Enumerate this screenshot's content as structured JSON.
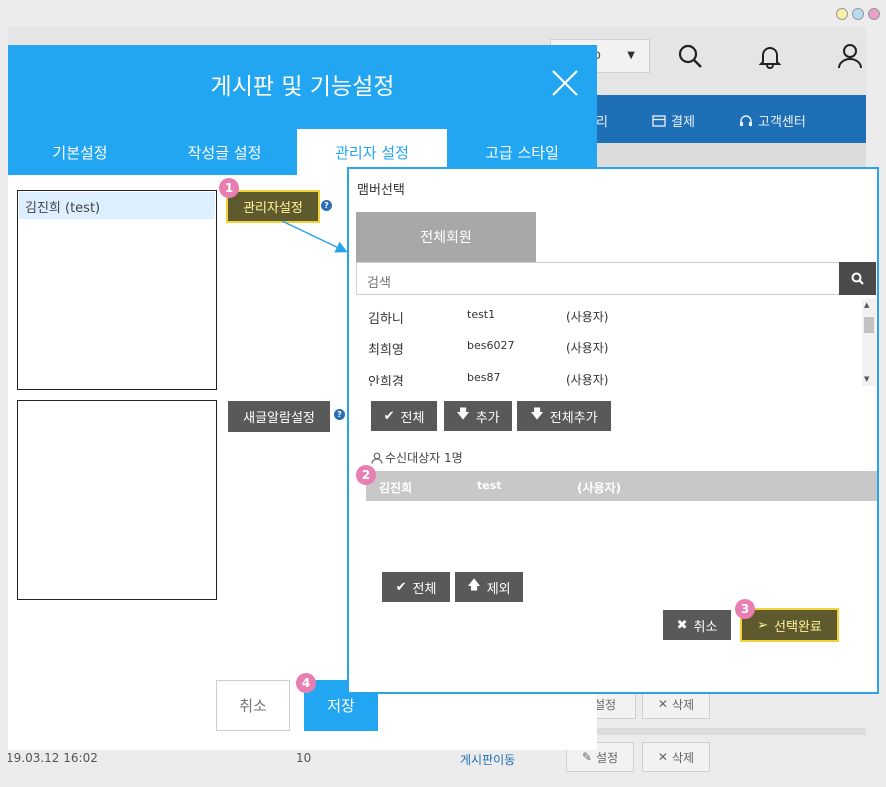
{
  "background": {
    "lang_select": "o",
    "nav": {
      "item_1": "리",
      "payment": "결제",
      "support": "고객센터"
    },
    "row1": {
      "edit": "설정",
      "delete": "삭제"
    },
    "row2": {
      "date": "19.03.12 16:02",
      "count": "10",
      "link": "게시판이동",
      "edit": "설정",
      "delete": "삭제"
    }
  },
  "dialog": {
    "title": "게시판 및 기능설정",
    "tabs": [
      "기본설정",
      "작성글 설정",
      "관리자 설정",
      "고급 스타일"
    ],
    "admin_list": [
      "김진희 (test)"
    ],
    "admin_button": "관리자설정",
    "alert_button": "새글알람설정",
    "cancel": "취소",
    "save": "저장"
  },
  "panel": {
    "title": "맴버선택",
    "tab_all": "전체회원",
    "search_placeholder": "검색",
    "members": [
      {
        "name": "김하니",
        "id": "test1",
        "role": "(사용자)"
      },
      {
        "name": "최희영",
        "id": "bes6027",
        "role": "(사용자)"
      },
      {
        "name": "안희경",
        "id": "bes87",
        "role": "(사용자)"
      }
    ],
    "btn_all": "전체",
    "btn_add": "추가",
    "btn_add_all": "전체추가",
    "recipients_label": "수신대상자 1명",
    "selected": [
      {
        "name": "김진희",
        "id": "test",
        "role": "(사용자)"
      }
    ],
    "btn_all2": "전체",
    "btn_remove": "제외",
    "btn_cancel": "취소",
    "btn_done": "선택완료"
  },
  "badges": [
    "1",
    "2",
    "3",
    "4"
  ],
  "colors": {
    "accent": "#22a6f2",
    "highlight": "#f3d33a",
    "badge": "#e77fb2",
    "dark_button": "#595959"
  }
}
